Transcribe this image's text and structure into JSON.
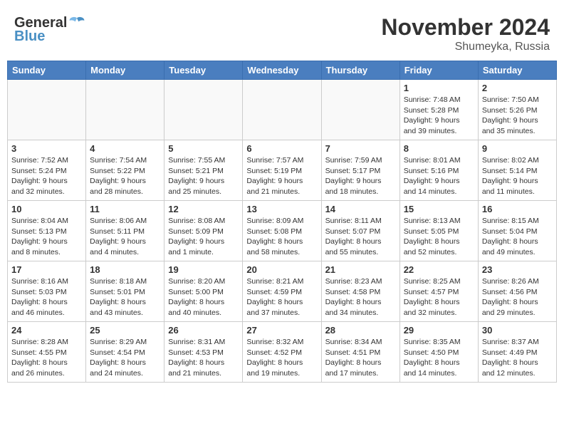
{
  "logo": {
    "line1": "General",
    "line2": "Blue"
  },
  "title": "November 2024",
  "location": "Shumeyka, Russia",
  "days_of_week": [
    "Sunday",
    "Monday",
    "Tuesday",
    "Wednesday",
    "Thursday",
    "Friday",
    "Saturday"
  ],
  "weeks": [
    [
      {
        "day": "",
        "info": "",
        "empty": true
      },
      {
        "day": "",
        "info": "",
        "empty": true
      },
      {
        "day": "",
        "info": "",
        "empty": true
      },
      {
        "day": "",
        "info": "",
        "empty": true
      },
      {
        "day": "",
        "info": "",
        "empty": true
      },
      {
        "day": "1",
        "info": "Sunrise: 7:48 AM\nSunset: 5:28 PM\nDaylight: 9 hours\nand 39 minutes."
      },
      {
        "day": "2",
        "info": "Sunrise: 7:50 AM\nSunset: 5:26 PM\nDaylight: 9 hours\nand 35 minutes."
      }
    ],
    [
      {
        "day": "3",
        "info": "Sunrise: 7:52 AM\nSunset: 5:24 PM\nDaylight: 9 hours\nand 32 minutes."
      },
      {
        "day": "4",
        "info": "Sunrise: 7:54 AM\nSunset: 5:22 PM\nDaylight: 9 hours\nand 28 minutes."
      },
      {
        "day": "5",
        "info": "Sunrise: 7:55 AM\nSunset: 5:21 PM\nDaylight: 9 hours\nand 25 minutes."
      },
      {
        "day": "6",
        "info": "Sunrise: 7:57 AM\nSunset: 5:19 PM\nDaylight: 9 hours\nand 21 minutes."
      },
      {
        "day": "7",
        "info": "Sunrise: 7:59 AM\nSunset: 5:17 PM\nDaylight: 9 hours\nand 18 minutes."
      },
      {
        "day": "8",
        "info": "Sunrise: 8:01 AM\nSunset: 5:16 PM\nDaylight: 9 hours\nand 14 minutes."
      },
      {
        "day": "9",
        "info": "Sunrise: 8:02 AM\nSunset: 5:14 PM\nDaylight: 9 hours\nand 11 minutes."
      }
    ],
    [
      {
        "day": "10",
        "info": "Sunrise: 8:04 AM\nSunset: 5:13 PM\nDaylight: 9 hours\nand 8 minutes."
      },
      {
        "day": "11",
        "info": "Sunrise: 8:06 AM\nSunset: 5:11 PM\nDaylight: 9 hours\nand 4 minutes."
      },
      {
        "day": "12",
        "info": "Sunrise: 8:08 AM\nSunset: 5:09 PM\nDaylight: 9 hours\nand 1 minute."
      },
      {
        "day": "13",
        "info": "Sunrise: 8:09 AM\nSunset: 5:08 PM\nDaylight: 8 hours\nand 58 minutes."
      },
      {
        "day": "14",
        "info": "Sunrise: 8:11 AM\nSunset: 5:07 PM\nDaylight: 8 hours\nand 55 minutes."
      },
      {
        "day": "15",
        "info": "Sunrise: 8:13 AM\nSunset: 5:05 PM\nDaylight: 8 hours\nand 52 minutes."
      },
      {
        "day": "16",
        "info": "Sunrise: 8:15 AM\nSunset: 5:04 PM\nDaylight: 8 hours\nand 49 minutes."
      }
    ],
    [
      {
        "day": "17",
        "info": "Sunrise: 8:16 AM\nSunset: 5:03 PM\nDaylight: 8 hours\nand 46 minutes."
      },
      {
        "day": "18",
        "info": "Sunrise: 8:18 AM\nSunset: 5:01 PM\nDaylight: 8 hours\nand 43 minutes."
      },
      {
        "day": "19",
        "info": "Sunrise: 8:20 AM\nSunset: 5:00 PM\nDaylight: 8 hours\nand 40 minutes."
      },
      {
        "day": "20",
        "info": "Sunrise: 8:21 AM\nSunset: 4:59 PM\nDaylight: 8 hours\nand 37 minutes."
      },
      {
        "day": "21",
        "info": "Sunrise: 8:23 AM\nSunset: 4:58 PM\nDaylight: 8 hours\nand 34 minutes."
      },
      {
        "day": "22",
        "info": "Sunrise: 8:25 AM\nSunset: 4:57 PM\nDaylight: 8 hours\nand 32 minutes."
      },
      {
        "day": "23",
        "info": "Sunrise: 8:26 AM\nSunset: 4:56 PM\nDaylight: 8 hours\nand 29 minutes."
      }
    ],
    [
      {
        "day": "24",
        "info": "Sunrise: 8:28 AM\nSunset: 4:55 PM\nDaylight: 8 hours\nand 26 minutes."
      },
      {
        "day": "25",
        "info": "Sunrise: 8:29 AM\nSunset: 4:54 PM\nDaylight: 8 hours\nand 24 minutes."
      },
      {
        "day": "26",
        "info": "Sunrise: 8:31 AM\nSunset: 4:53 PM\nDaylight: 8 hours\nand 21 minutes."
      },
      {
        "day": "27",
        "info": "Sunrise: 8:32 AM\nSunset: 4:52 PM\nDaylight: 8 hours\nand 19 minutes."
      },
      {
        "day": "28",
        "info": "Sunrise: 8:34 AM\nSunset: 4:51 PM\nDaylight: 8 hours\nand 17 minutes."
      },
      {
        "day": "29",
        "info": "Sunrise: 8:35 AM\nSunset: 4:50 PM\nDaylight: 8 hours\nand 14 minutes."
      },
      {
        "day": "30",
        "info": "Sunrise: 8:37 AM\nSunset: 4:49 PM\nDaylight: 8 hours\nand 12 minutes."
      }
    ]
  ]
}
